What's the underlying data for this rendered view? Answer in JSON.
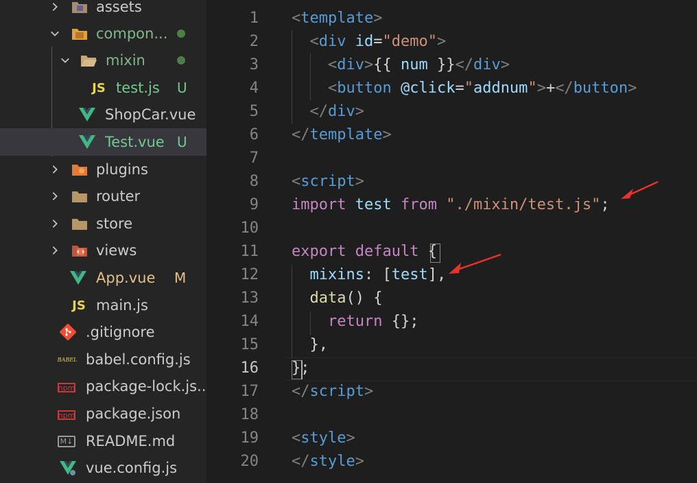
{
  "explorer": {
    "items": [
      {
        "label": "assets"
      },
      {
        "label": "compon...",
        "status": "dot"
      },
      {
        "label": "mixin",
        "status": "dot"
      },
      {
        "label": "test.js",
        "status": "U",
        "icon_text": "JS"
      },
      {
        "label": "ShopCar.vue"
      },
      {
        "label": "Test.vue",
        "status": "U"
      },
      {
        "label": "plugins"
      },
      {
        "label": "router"
      },
      {
        "label": "store"
      },
      {
        "label": "views"
      },
      {
        "label": "App.vue",
        "status": "M"
      },
      {
        "label": "main.js",
        "icon_text": "JS"
      },
      {
        "label": ".gitignore"
      },
      {
        "label": "babel.config.js",
        "icon_text": "BABEL"
      },
      {
        "label": "package-lock.js...",
        "icon_text": "npm"
      },
      {
        "label": "package.json",
        "icon_text": "npm"
      },
      {
        "label": "README.md",
        "icon_text": "M↓"
      },
      {
        "label": "vue.config.js"
      }
    ]
  },
  "editor": {
    "active_line": "16",
    "lines": [
      {
        "n": "1",
        "tokens": [
          [
            "p",
            "<"
          ],
          [
            "tag",
            "template"
          ],
          [
            "p",
            ">"
          ]
        ]
      },
      {
        "n": "2",
        "tokens": [
          [
            "txt",
            "  "
          ],
          [
            "p",
            "<"
          ],
          [
            "tag",
            "div"
          ],
          [
            "txt",
            " "
          ],
          [
            "attr",
            "id"
          ],
          [
            "txt",
            "="
          ],
          [
            "str",
            "\"demo\""
          ],
          [
            "p",
            ">"
          ]
        ]
      },
      {
        "n": "3",
        "tokens": [
          [
            "txt",
            "    "
          ],
          [
            "p",
            "<"
          ],
          [
            "tag",
            "div"
          ],
          [
            "p",
            ">"
          ],
          [
            "txt",
            "{{ "
          ],
          [
            "var",
            "num"
          ],
          [
            "txt",
            " }}"
          ],
          [
            "p",
            "</"
          ],
          [
            "tag",
            "div"
          ],
          [
            "p",
            ">"
          ]
        ]
      },
      {
        "n": "4",
        "tokens": [
          [
            "txt",
            "    "
          ],
          [
            "p",
            "<"
          ],
          [
            "tag",
            "button"
          ],
          [
            "txt",
            " "
          ],
          [
            "attr",
            "@click"
          ],
          [
            "txt",
            "="
          ],
          [
            "str",
            "\""
          ],
          [
            "var",
            "addnum"
          ],
          [
            "str",
            "\""
          ],
          [
            "p",
            ">"
          ],
          [
            "txt",
            "+"
          ],
          [
            "p",
            "</"
          ],
          [
            "tag",
            "button"
          ],
          [
            "p",
            ">"
          ]
        ]
      },
      {
        "n": "5",
        "tokens": [
          [
            "txt",
            "  "
          ],
          [
            "p",
            "</"
          ],
          [
            "tag",
            "div"
          ],
          [
            "p",
            ">"
          ]
        ]
      },
      {
        "n": "6",
        "tokens": [
          [
            "p",
            "</"
          ],
          [
            "tag",
            "template"
          ],
          [
            "p",
            ">"
          ]
        ]
      },
      {
        "n": "7",
        "tokens": []
      },
      {
        "n": "8",
        "tokens": [
          [
            "p",
            "<"
          ],
          [
            "tag",
            "script"
          ],
          [
            "p",
            ">"
          ]
        ]
      },
      {
        "n": "9",
        "tokens": [
          [
            "kw",
            "import"
          ],
          [
            "txt",
            " "
          ],
          [
            "var",
            "test"
          ],
          [
            "txt",
            " "
          ],
          [
            "kw",
            "from"
          ],
          [
            "txt",
            " "
          ],
          [
            "str",
            "\"./mixin/test.js\""
          ],
          [
            "txt",
            ";"
          ]
        ]
      },
      {
        "n": "10",
        "tokens": []
      },
      {
        "n": "11",
        "tokens": [
          [
            "kw",
            "export"
          ],
          [
            "txt",
            " "
          ],
          [
            "kw",
            "default"
          ],
          [
            "txt",
            " {"
          ]
        ]
      },
      {
        "n": "12",
        "tokens": [
          [
            "txt",
            "  "
          ],
          [
            "var",
            "mixins"
          ],
          [
            "txt",
            ": ["
          ],
          [
            "var",
            "test"
          ],
          [
            "txt",
            "],"
          ]
        ]
      },
      {
        "n": "13",
        "tokens": [
          [
            "txt",
            "  "
          ],
          [
            "fn",
            "data"
          ],
          [
            "txt",
            "() {"
          ]
        ]
      },
      {
        "n": "14",
        "tokens": [
          [
            "txt",
            "    "
          ],
          [
            "kw",
            "return"
          ],
          [
            "txt",
            " {};"
          ]
        ]
      },
      {
        "n": "15",
        "tokens": [
          [
            "txt",
            "  },"
          ]
        ]
      },
      {
        "n": "16",
        "tokens": [
          [
            "txt",
            "};"
          ]
        ]
      },
      {
        "n": "17",
        "tokens": [
          [
            "p",
            "</"
          ],
          [
            "tag",
            "script"
          ],
          [
            "p",
            ">"
          ]
        ]
      },
      {
        "n": "18",
        "tokens": []
      },
      {
        "n": "19",
        "tokens": [
          [
            "p",
            "<"
          ],
          [
            "tag",
            "style"
          ],
          [
            "p",
            ">"
          ]
        ]
      },
      {
        "n": "20",
        "tokens": [
          [
            "p",
            "</"
          ],
          [
            "tag",
            "style"
          ],
          [
            "p",
            ">"
          ]
        ]
      }
    ]
  },
  "colors": {
    "status_u": "#73c991",
    "status_m": "#e2c08d",
    "folder_modified_label": "#81b88b",
    "annotation_arrow": "#e8322b"
  }
}
